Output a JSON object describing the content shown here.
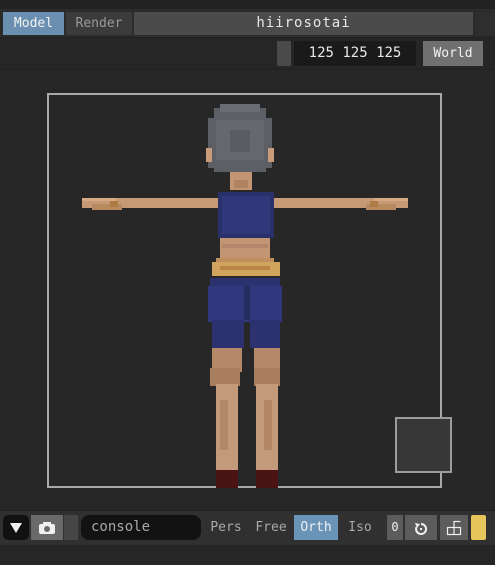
{
  "header": {
    "modes": [
      {
        "label": "Model",
        "active": true
      },
      {
        "label": "Render",
        "active": false
      }
    ],
    "filename": "hiirosotai"
  },
  "toolbar": {
    "dimensions": "125 125 125",
    "space_label": "World"
  },
  "bottombar": {
    "menu_icon": "triangle-down-icon",
    "camera_icon": "camera-icon",
    "console_label": "console",
    "views": [
      {
        "label": "Pers",
        "active": false
      },
      {
        "label": "Free",
        "active": false
      },
      {
        "label": "Orth",
        "active": true
      },
      {
        "label": "Iso",
        "active": false
      }
    ],
    "zero_label": "0",
    "reset_icon": "rotate-ccw-icon",
    "grid_icon": "grid-icon",
    "accent_color": "#e6c65a",
    "active_color": "#6a93b8"
  }
}
